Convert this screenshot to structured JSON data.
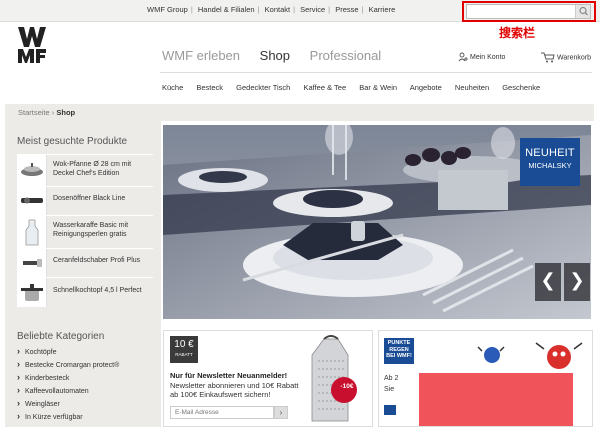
{
  "topbar": {
    "links": [
      "WMF Group",
      "Handel & Filialen",
      "Kontakt",
      "Service",
      "Presse",
      "Karriere"
    ],
    "search_placeholder": "",
    "search_annotation": "搜索栏"
  },
  "logo": {
    "alt": "WMF"
  },
  "mainnav": {
    "items": [
      "WMF erleben",
      "Shop",
      "Professional"
    ],
    "active": "Shop",
    "account_label": "Mein Konto",
    "cart_label": "Warenkorb"
  },
  "subnav": {
    "items": [
      "Küche",
      "Besteck",
      "Gedeckter Tisch",
      "Kaffee & Tee",
      "Bar & Wein",
      "Angebote",
      "Neuheiten",
      "Geschenke"
    ]
  },
  "breadcrumb": {
    "home": "Startseite",
    "sep": "›",
    "current": "Shop"
  },
  "left": {
    "popular_title": "Meist gesuchte Produkte",
    "products": [
      {
        "name": "Wok-Pfanne Ø 28 cm mit Deckel Chef's Edition",
        "icon": "wok-icon"
      },
      {
        "name": "Dosenöffner Black Line",
        "icon": "can-opener-icon"
      },
      {
        "name": "Wasserkaraffe Basic mit Reinigungsperlen gratis",
        "icon": "carafe-icon"
      },
      {
        "name": "Ceranfeldschaber Profi Plus",
        "icon": "scraper-icon"
      },
      {
        "name": "Schnellkochtopf 4,5 l Perfect",
        "icon": "pressure-cooker-icon"
      }
    ],
    "categories_title": "Beliebte Kategorien",
    "categories": [
      "Kochtöpfe",
      "Bestecke Cromargan protect®",
      "Kinderbesteck",
      "Kaffeevollautomaten",
      "Weingläser",
      "In Kürze verfügbar"
    ]
  },
  "hero": {
    "badge_line1": "NEUHEIT",
    "badge_line2": "MICHALSKY",
    "prev": "❮",
    "next": "❯"
  },
  "newsletter": {
    "badge_big": "10 €",
    "badge_small": "RABATT",
    "heading": "Nur für Newsletter Neuanmelder!",
    "text": "Newsletter abonnieren und 10€ Rabatt ab 100€ Einkaufswert sichern!",
    "input_placeholder": "E-Mail Adresse",
    "submit": "›",
    "sticker": "-10€"
  },
  "punkte": {
    "badge": "PUNKTE REGEN BEI WMF!",
    "text1": "Ab 2",
    "text2": "Sie"
  },
  "colors": {
    "accent_blue": "#1a4c96",
    "annotation_red": "#e00000",
    "promo_red": "#f0535a"
  }
}
